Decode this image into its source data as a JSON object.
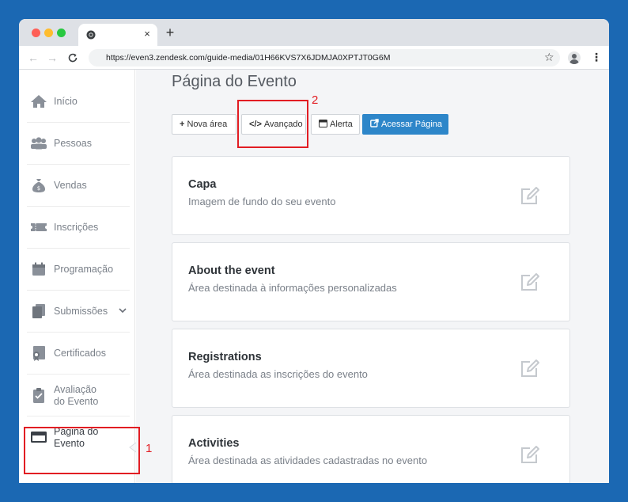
{
  "browser": {
    "url": "https://even3.zendesk.com/guide-media/01H66KVS7X6JDMJA0XPTJT0G6M",
    "tab_close": "×",
    "new_tab": "+",
    "back": "←",
    "forward": "→",
    "reload": "C",
    "star": "☆",
    "menu": "⋮"
  },
  "sidebar": {
    "items": [
      {
        "label": "Início",
        "icon": "home-icon"
      },
      {
        "label": "Pessoas",
        "icon": "people-icon"
      },
      {
        "label": "Vendas",
        "icon": "money-bag-icon"
      },
      {
        "label": "Inscrições",
        "icon": "ticket-icon"
      },
      {
        "label": "Programação",
        "icon": "calendar-icon"
      },
      {
        "label": "Submissões",
        "icon": "documents-icon"
      },
      {
        "label": "Certificados",
        "icon": "certificate-icon"
      },
      {
        "label_line1": "Avaliação",
        "label_line2": "do Evento",
        "icon": "clipboard-icon"
      },
      {
        "label_line1": "Página do",
        "label_line2": "Evento",
        "icon": "browser-window-icon"
      }
    ],
    "submissoes_chevron": "⌄"
  },
  "main": {
    "title": "Página do Evento",
    "buttons": {
      "nova_area": "Nova área",
      "nova_area_icon": "+",
      "avancado": "Avançado",
      "avancado_icon": "</>",
      "alerta": "Alerta",
      "acessar": "Acessar Página"
    },
    "cards": [
      {
        "title": "Capa",
        "desc": "Imagem de fundo do seu evento"
      },
      {
        "title": "About the event",
        "desc": "Área destinada à informações personalizadas"
      },
      {
        "title": "Registrations",
        "desc": "Área destinada as inscrições do evento"
      },
      {
        "title": "Activities",
        "desc": "Área destinada as atividades cadastradas no evento"
      }
    ]
  },
  "annotations": {
    "one": "1",
    "two": "2",
    "color": "#e21d23"
  },
  "colors": {
    "background": "#1b68b3",
    "primary_button": "#2d86c9"
  }
}
